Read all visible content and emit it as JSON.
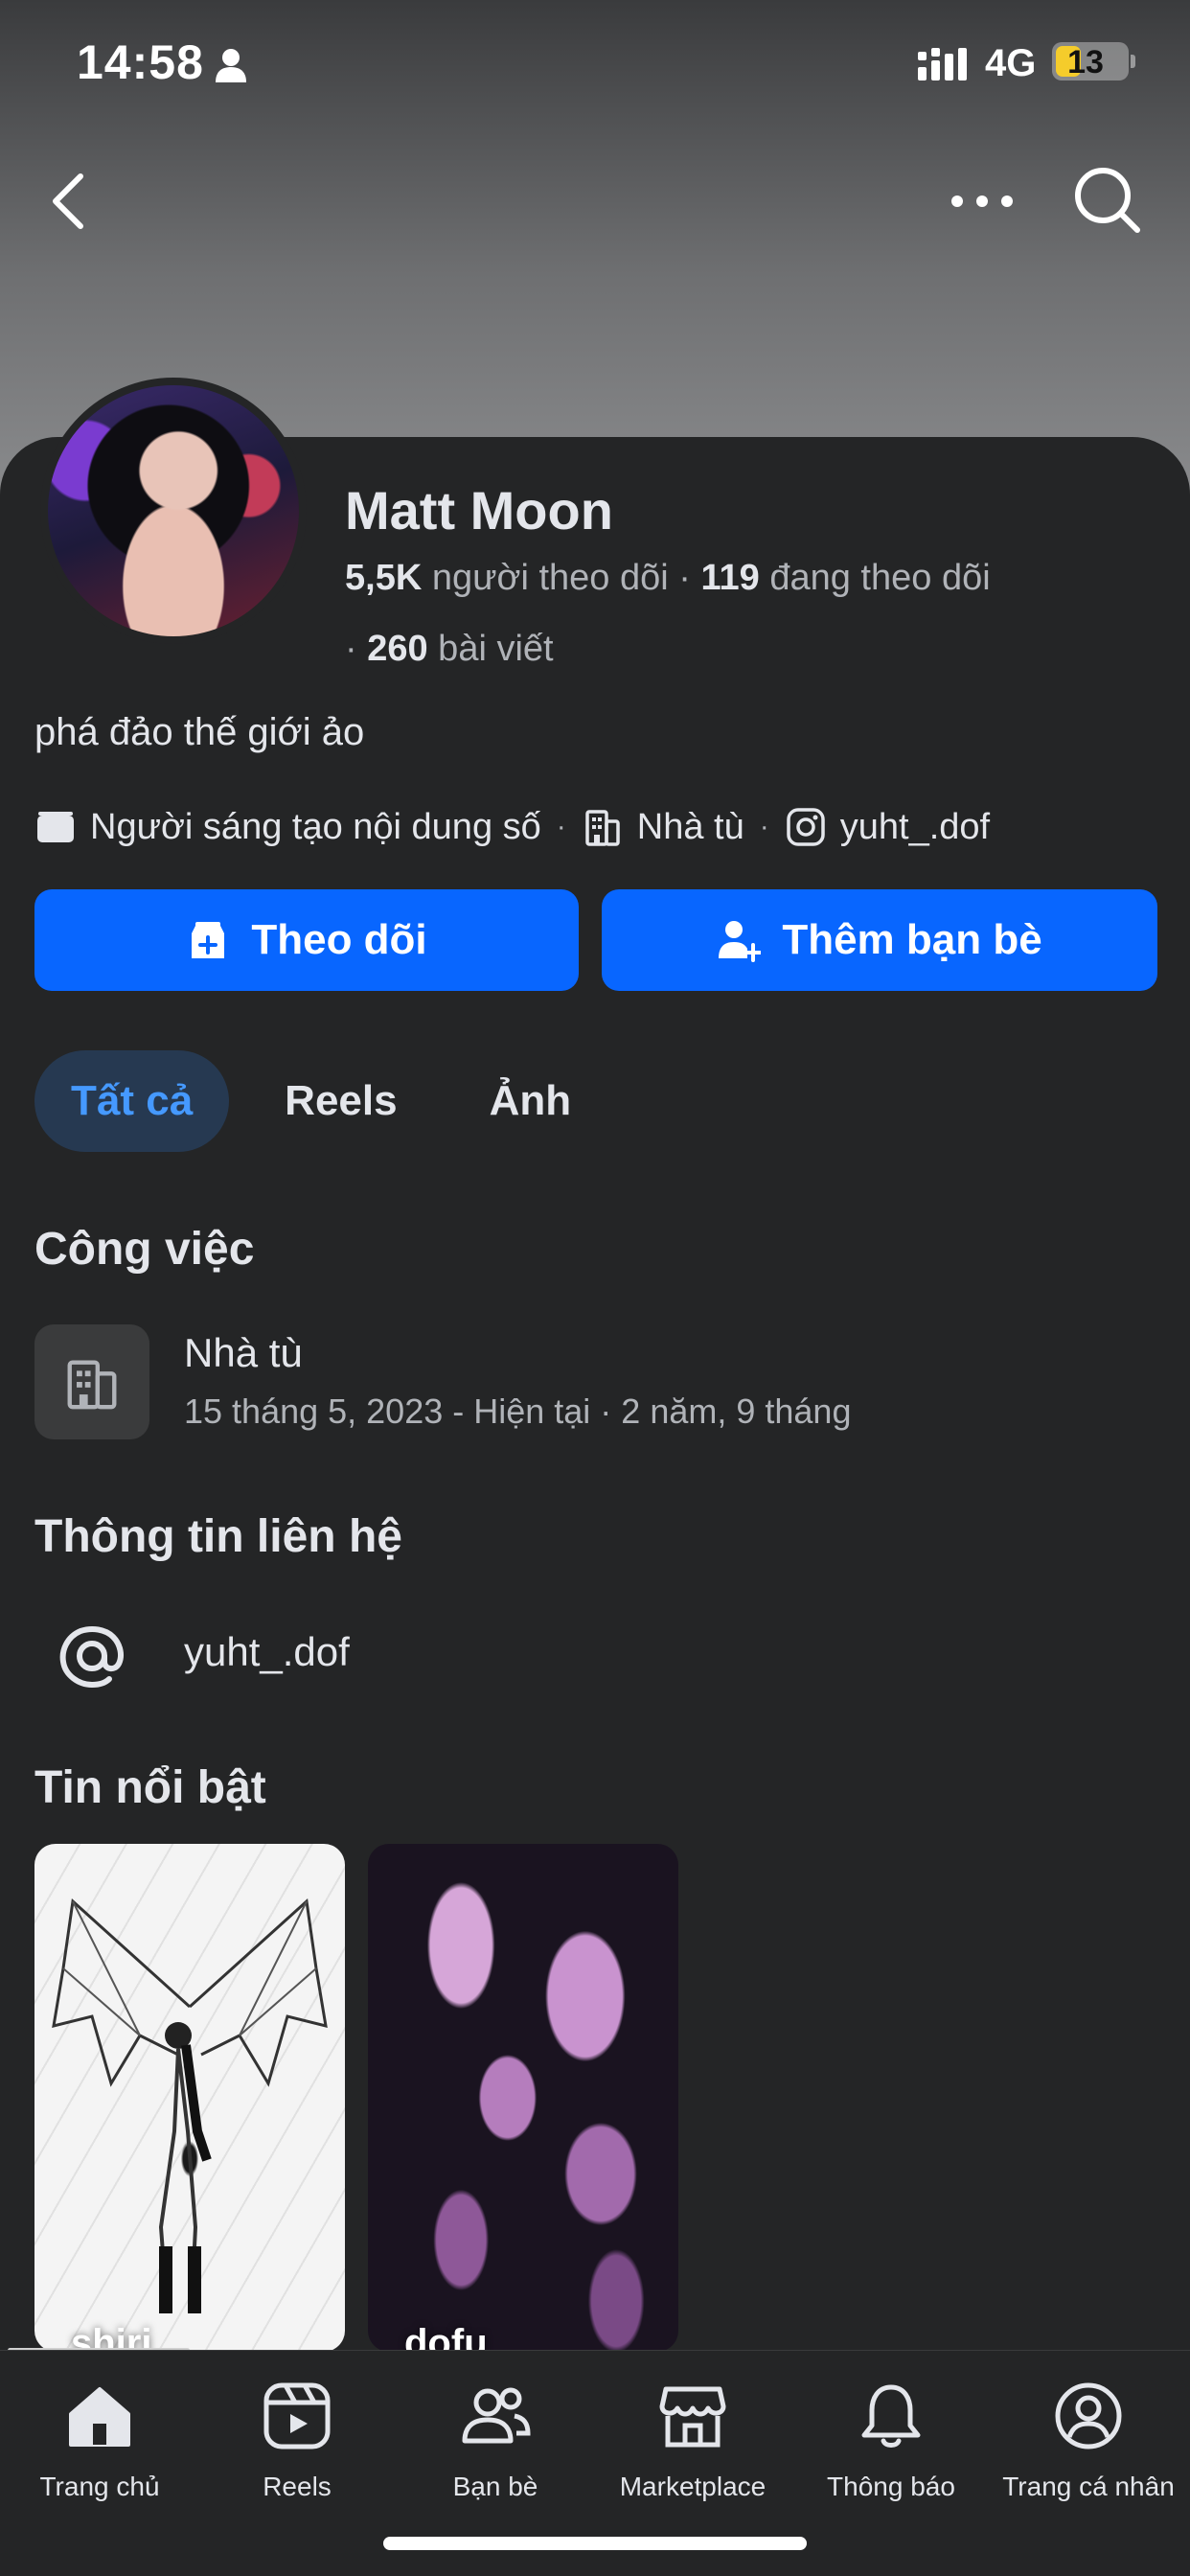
{
  "status_bar": {
    "time": "14:58",
    "network": "4G",
    "battery": "13"
  },
  "profile": {
    "name": "Matt Moon",
    "followers_count": "5,5K",
    "followers_label": " người theo dõi · ",
    "following_count": "119",
    "following_label": " đang theo dõi",
    "posts_prefix": "· ",
    "posts_count": "260",
    "posts_label": " bài viết",
    "bio": "phá đảo thế giới ảo",
    "category": "Người sáng tạo nội dung số",
    "workplace": "Nhà tù",
    "instagram": "yuht_.dof"
  },
  "actions": {
    "follow_label": "Theo dõi",
    "add_friend_label": "Thêm bạn bè"
  },
  "tabs": [
    {
      "label": "Tất cả",
      "active": true
    },
    {
      "label": "Reels"
    },
    {
      "label": "Ảnh"
    }
  ],
  "work": {
    "title": "Công việc",
    "place": "Nhà tù",
    "dates": "15 tháng 5, 2023 - Hiện tại · 2 năm, 9 tháng"
  },
  "contact": {
    "title": "Thông tin liên hệ",
    "handle": "yuht_.dof"
  },
  "highlights": {
    "title": "Tin nổi bật",
    "items": [
      {
        "label": "shiri"
      },
      {
        "label": "dofu"
      }
    ]
  },
  "bottom_nav": [
    {
      "label": "Trang chủ",
      "icon": "home-icon"
    },
    {
      "label": "Reels",
      "icon": "reels-icon"
    },
    {
      "label": "Bạn bè",
      "icon": "friends-icon"
    },
    {
      "label": "Marketplace",
      "icon": "marketplace-icon"
    },
    {
      "label": "Thông báo",
      "icon": "bell-icon"
    },
    {
      "label": "Trang cá nhân",
      "icon": "profile-icon"
    }
  ],
  "colors": {
    "accent": "#0866ff",
    "background": "#242526",
    "active_tab_bg": "#263951",
    "active_tab_text": "#4599ff"
  }
}
